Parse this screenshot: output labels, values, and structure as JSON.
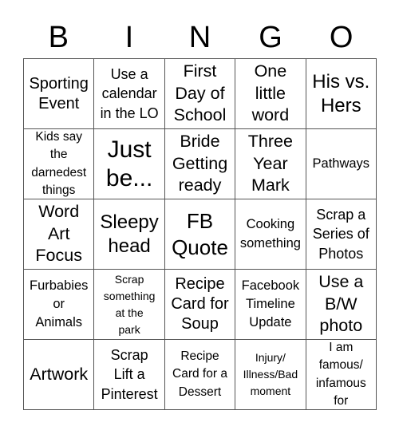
{
  "title_letters": [
    "B",
    "I",
    "N",
    "G",
    "O"
  ],
  "cells": [
    [
      "Sporting\nEvent",
      "Use a\ncalendar\nin the LO",
      "First\nDay of\nSchool",
      "One\nlittle\nword",
      "His vs.\nHers"
    ],
    [
      "Kids say\nthe\ndarnedest\nthings",
      "Just\nbe...",
      "Bride\nGetting\nready",
      "Three\nYear\nMark",
      "Pathways"
    ],
    [
      "Word\nArt\nFocus",
      "Sleepy\nhead",
      "FB\nQuote",
      "Cooking\nsomething",
      "Scrap a\nSeries of\nPhotos"
    ],
    [
      "Furbabies\nor\nAnimals",
      "Scrap\nsomething\nat the\npark",
      "Recipe\nCard for\nSoup",
      "Facebook\nTimeline\nUpdate",
      "Use a\nB/W\nphoto"
    ],
    [
      "Artwork",
      "Scrap\nLift a\nPinterest",
      "Recipe\nCard for a\nDessert",
      "Injury/\nIllness/Bad\nmoment",
      "I am\nfamous/\ninfamous\nfor"
    ]
  ]
}
